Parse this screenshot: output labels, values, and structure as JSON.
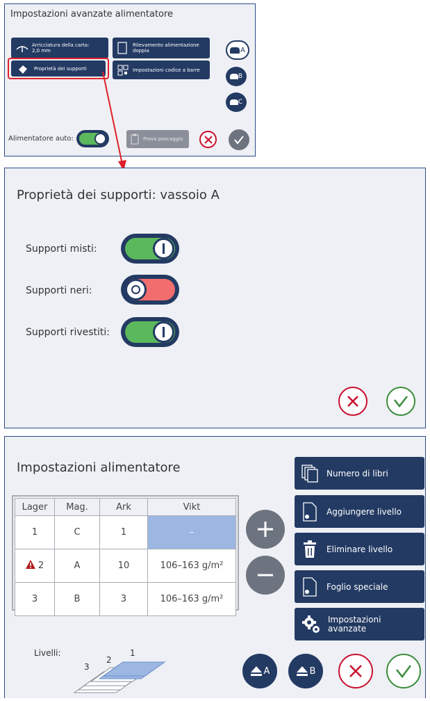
{
  "panel1": {
    "title": "Impostazioni avanzate alimentatore",
    "btn_curl_label": "Arricciatura della carta:",
    "btn_curl_value": "2,0 mm",
    "btn_double_label": "Rilevamento alimentazione doppia",
    "btn_media_label": "Proprietà dei supporti",
    "btn_barcode_label": "Impostazioni codice a barre",
    "tray_a": "A",
    "tray_b": "B",
    "tray_c": "C",
    "auto_feeder_label": "Alimentatore auto:",
    "auto_feeder_on": true,
    "test_feed_label": "Prova pescaggio"
  },
  "panel2": {
    "title": "Proprietà dei supporti: vassoio A",
    "options": [
      {
        "label": "Supporti misti:",
        "on": true
      },
      {
        "label": "Supporti neri:",
        "on": false
      },
      {
        "label": "Supporti rivestiti:",
        "on": true
      }
    ]
  },
  "panel3": {
    "title": "Impostazioni alimentatore",
    "table": {
      "headers": [
        "Lager",
        "Mag.",
        "Ark",
        "Vikt"
      ],
      "rows": [
        {
          "level": "1",
          "mag": "C",
          "sheets": "1",
          "weight": "–",
          "warning": false,
          "selected": true
        },
        {
          "level": "2",
          "mag": "A",
          "sheets": "10",
          "weight": "106–163 g/m²",
          "warning": true,
          "selected": false
        },
        {
          "level": "3",
          "mag": "B",
          "sheets": "3",
          "weight": "106–163 g/m²",
          "warning": false,
          "selected": false
        }
      ]
    },
    "actions": {
      "books": "Numero di libri",
      "add_level": "Aggiungere livello",
      "delete_level": "Eliminare livello",
      "special_sheet": "Foglio speciale",
      "advanced_line1": "Impostazioni",
      "advanced_line2": "avanzate"
    },
    "levels_label": "Livelli:",
    "level_numbers": [
      "3",
      "2",
      "1"
    ],
    "eject_a": "A",
    "eject_b": "B"
  },
  "colors": {
    "navy": "#233a63",
    "highlight_red": "#e0202a",
    "toggle_green": "#5cb85c",
    "toggle_red": "#f26d6d",
    "cancel_red": "#c8102e",
    "ok_green": "#3c8c3c",
    "selected_cell": "#9db7e3"
  }
}
